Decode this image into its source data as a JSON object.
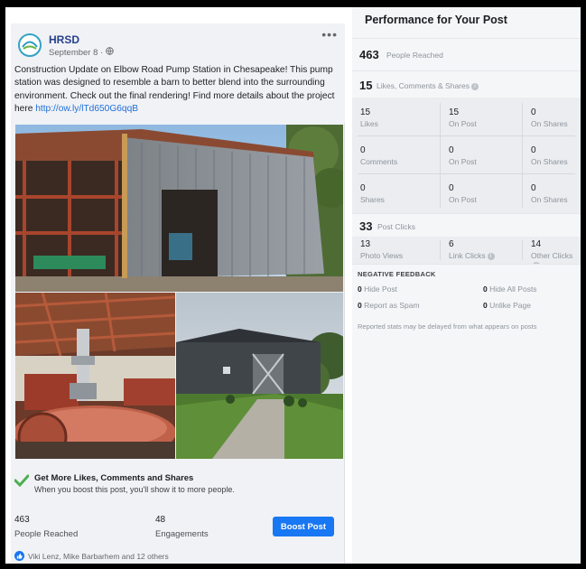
{
  "post": {
    "page_name": "HRSD",
    "date": "September 8 · ",
    "text": "Construction Update on Elbow Road Pump Station in Chesapeake! This pump station was designed to resemble a barn to better blend into the surrounding environment. Check out the final rendering! Find more details about the project here ",
    "link": "http://ow.ly/lTd650G6qqB",
    "boost_cta_title": "Get More Likes, Comments and Shares",
    "boost_cta_desc": "When you boost this post, you'll show it to more people.",
    "people_reached_value": "463",
    "people_reached_label": "People Reached",
    "engagements_value": "48",
    "engagements_label": "Engagements",
    "boost_button": "Boost Post",
    "reactions_text": "Viki Lenz, Mike Barbarhem and 12 others"
  },
  "panel": {
    "title": "Performance for Your Post",
    "reached_value": "463",
    "reached_label": "People Reached",
    "lcs_value": "15",
    "lcs_label": "Likes, Comments & Shares",
    "rows": [
      [
        {
          "num": "15",
          "label": "Likes"
        },
        {
          "num": "15",
          "label": "On Post"
        },
        {
          "num": "0",
          "label": "On Shares"
        }
      ],
      [
        {
          "num": "0",
          "label": "Comments"
        },
        {
          "num": "0",
          "label": "On Post"
        },
        {
          "num": "0",
          "label": "On Shares"
        }
      ],
      [
        {
          "num": "0",
          "label": "Shares"
        },
        {
          "num": "0",
          "label": "On Post"
        },
        {
          "num": "0",
          "label": "On Shares"
        }
      ]
    ],
    "clicks_value": "33",
    "clicks_label": "Post Clicks",
    "clicks": [
      {
        "num": "13",
        "label": "Photo Views"
      },
      {
        "num": "6",
        "label": "Link Clicks"
      },
      {
        "num": "14",
        "label": "Other Clicks"
      }
    ],
    "negative_title": "NEGATIVE FEEDBACK",
    "negative": [
      {
        "num": "0",
        "label": "Hide Post"
      },
      {
        "num": "0",
        "label": "Hide All Posts"
      },
      {
        "num": "0",
        "label": "Report as Spam"
      },
      {
        "num": "0",
        "label": "Unlike Page"
      }
    ],
    "footnote": "Reported stats may be delayed from what appears on posts"
  },
  "icons": [
    "hrsd-logo-icon",
    "globe-icon",
    "more-options-icon",
    "check-icon",
    "like-icon",
    "info-icon"
  ],
  "colors": {
    "link": "#216fdb",
    "boost": "#1877f2",
    "page_name": "#263f8d",
    "check": "#4caf50"
  }
}
